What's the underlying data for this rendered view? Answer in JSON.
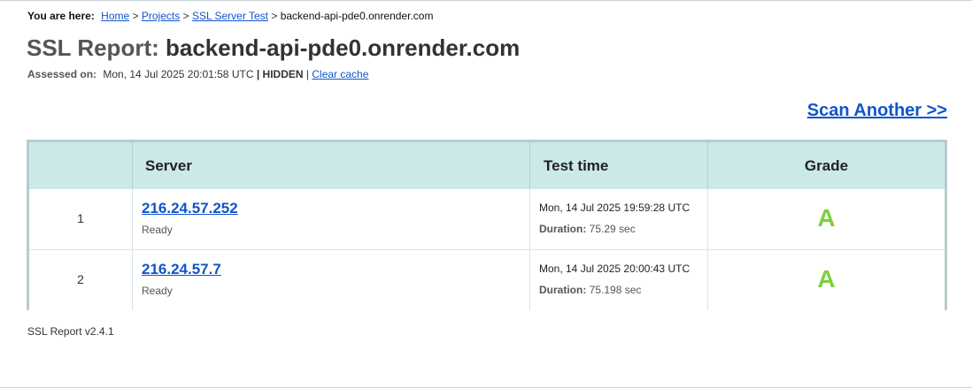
{
  "breadcrumb": {
    "prefix": "You are here:",
    "items": [
      "Home",
      "Projects",
      "SSL Server Test"
    ],
    "separator": ">",
    "current": "backend-api-pde0.onrender.com"
  },
  "report": {
    "title_prefix": "SSL Report:",
    "hostname": "backend-api-pde0.onrender.com",
    "assessed_label": "Assessed on:",
    "assessed_value": "Mon, 14 Jul 2025 20:01:58 UTC",
    "pipe": "|",
    "hidden": "HIDDEN",
    "clear_cache": "Clear cache"
  },
  "scan_another": "Scan Another >>",
  "table": {
    "headers": [
      "",
      "Server",
      "Test time",
      "Grade"
    ],
    "duration_label": "Duration:",
    "rows": [
      {
        "index": "1",
        "ip": "216.24.57.252",
        "status": "Ready",
        "test_time": "Mon, 14 Jul 2025 19:59:28 UTC",
        "duration": "75.29 sec",
        "grade": "A"
      },
      {
        "index": "2",
        "ip": "216.24.57.7",
        "status": "Ready",
        "test_time": "Mon, 14 Jul 2025 20:00:43 UTC",
        "duration": "75.198 sec",
        "grade": "A"
      }
    ]
  },
  "footer": {
    "version": "SSL Report v2.4.1"
  },
  "colors": {
    "link": "#1155cc",
    "grade_a": "#7ed13a",
    "header_bg": "#cce9e9",
    "table_border": "#b7cccd"
  }
}
